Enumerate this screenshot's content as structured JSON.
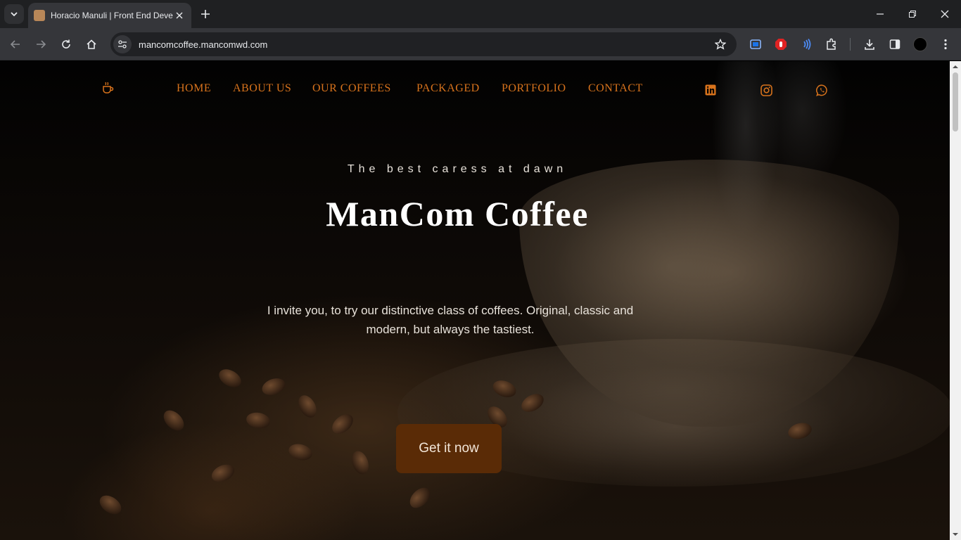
{
  "browser": {
    "tab_title": "Horacio Manuli | Front End Developer",
    "url": "mancomcoffee.mancomwd.com"
  },
  "nav": {
    "links": [
      "HOME",
      "ABOUT US",
      "OUR COFFEES",
      "PACKAGED",
      "PORTFOLIO",
      "CONTACT"
    ],
    "social": [
      "linkedin-icon",
      "instagram-icon",
      "whatsapp-icon"
    ],
    "accent": "#d8731c"
  },
  "hero": {
    "tagline": "The best caress at dawn",
    "title": "ManCom Coffee",
    "intro": "I invite you, to try our distinctive class of coffees. Original, classic and modern, but always the tastiest.",
    "cta_label": "Get it now",
    "cta_color": "#5a2b06"
  }
}
